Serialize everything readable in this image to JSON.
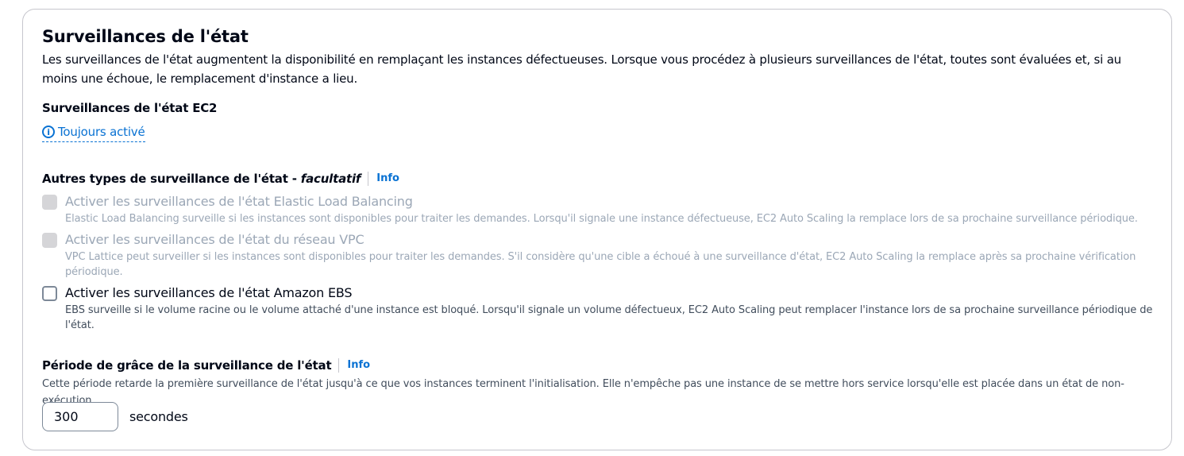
{
  "section": {
    "title": "Surveillances de l'état",
    "description": "Les surveillances de l'état augmentent la disponibilité en remplaçant les instances défectueuses. Lorsque vous procédez à plusieurs surveillances de l'état, toutes sont évaluées et, si au moins une échoue, le remplacement d'instance a lieu."
  },
  "ec2": {
    "label": "Surveillances de l'état EC2",
    "status_icon": "info-circle-icon",
    "status": "Toujours activé"
  },
  "other_types": {
    "label": "Autres types de surveillance de l'état - ",
    "optional": "facultatif",
    "info": "Info",
    "options": [
      {
        "title": "Activer les surveillances de l'état Elastic Load Balancing",
        "description": "Elastic Load Balancing surveille si les instances sont disponibles pour traiter les demandes. Lorsqu'il signale une instance défectueuse, EC2 Auto Scaling la remplace lors de sa prochaine surveillance périodique.",
        "checked": false,
        "disabled": true
      },
      {
        "title": "Activer les surveillances de l'état du réseau VPC",
        "description": "VPC Lattice peut surveiller si les instances sont disponibles pour traiter les demandes. S'il considère qu'une cible a échoué à une surveillance d'état, EC2 Auto Scaling la remplace après sa prochaine vérification périodique.",
        "checked": false,
        "disabled": true
      },
      {
        "title": "Activer les surveillances de l'état Amazon EBS",
        "description": "EBS surveille si le volume racine ou le volume attaché d'une instance est bloqué. Lorsqu'il signale un volume défectueux, EC2 Auto Scaling peut remplacer l'instance lors de sa prochaine surveillance périodique de l'état.",
        "checked": false,
        "disabled": false
      }
    ]
  },
  "grace_period": {
    "label": "Période de grâce de la surveillance de l'état",
    "info": "Info",
    "description": "Cette période retarde la première surveillance de l'état jusqu'à ce que vos instances terminent l'initialisation. Elle n'empêche pas une instance de se mettre hors service lorsqu'elle est placée dans un état de non-exécution.",
    "value": "300",
    "unit": "secondes"
  },
  "colors": {
    "link": "#0972d3",
    "text": "#000716",
    "secondary_text": "#414d5c",
    "disabled_text": "#9ba7b6",
    "border": "#c6c6cd"
  }
}
